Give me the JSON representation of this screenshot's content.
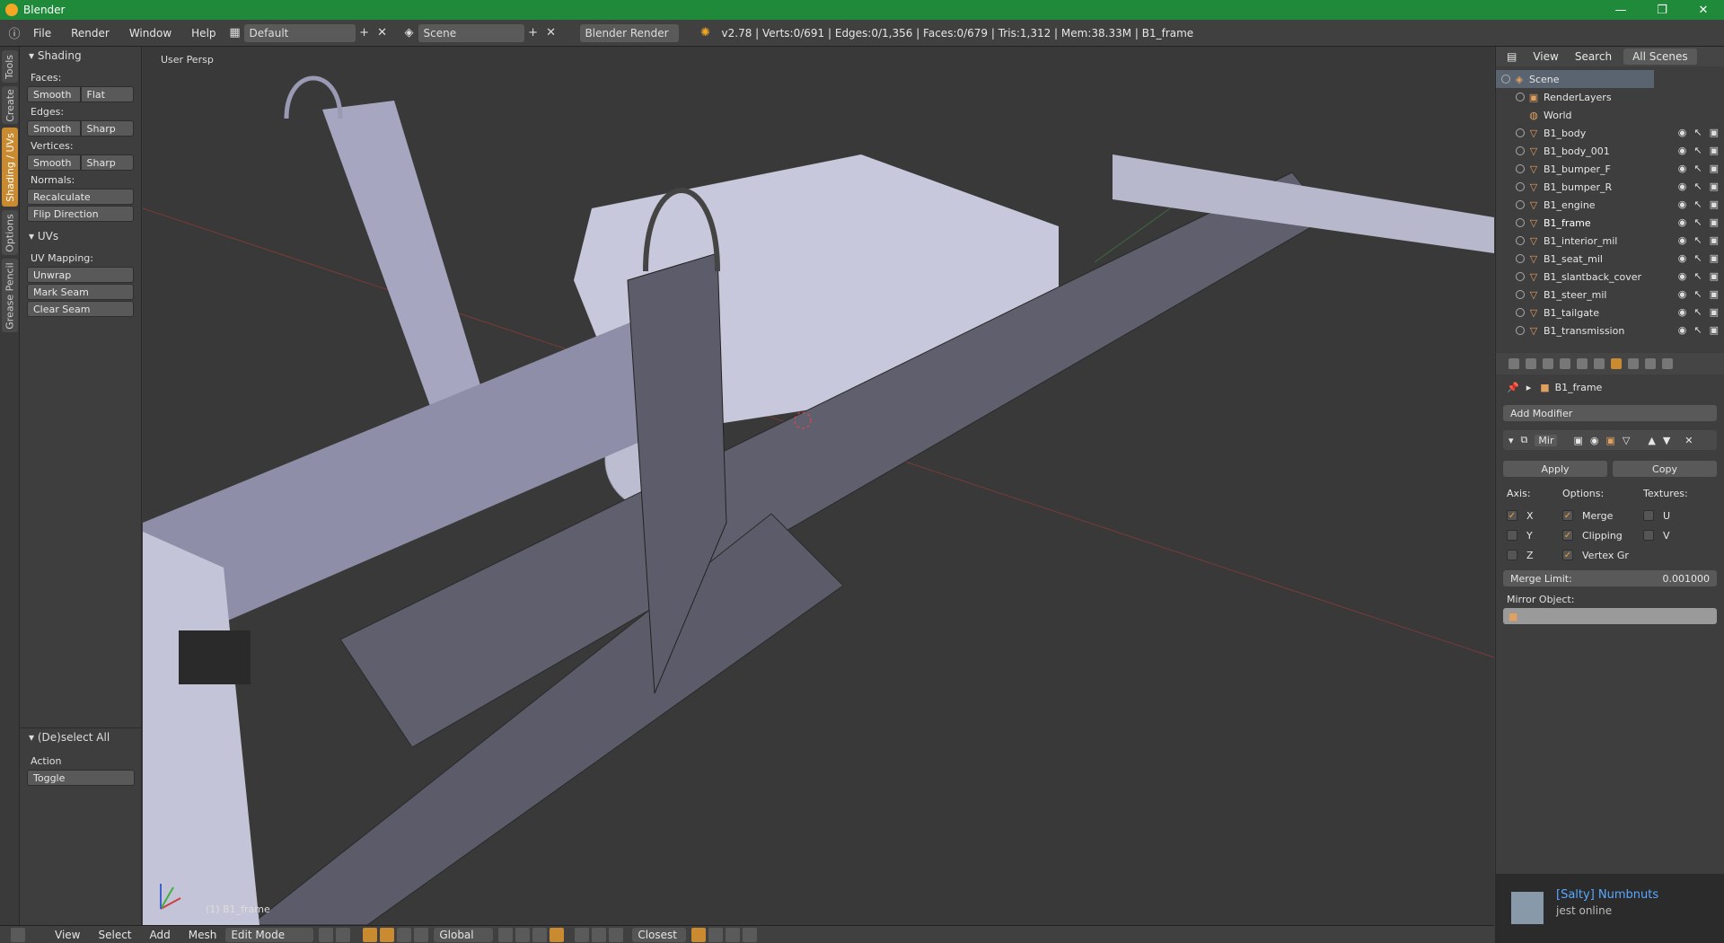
{
  "window": {
    "title": "Blender",
    "minimize": "—",
    "maximize": "❐",
    "close": "✕"
  },
  "topbar": {
    "menus": [
      "File",
      "Render",
      "Window",
      "Help"
    ],
    "layout": "Default",
    "scene": "Scene",
    "engine": "Blender Render",
    "stats": "v2.78 | Verts:0/691 | Edges:0/1,356 | Faces:0/679 | Tris:1,312 | Mem:38.33M | B1_frame"
  },
  "left_tabs": [
    "Tools",
    "Create",
    "Shading / UVs",
    "Options",
    "Grease Pencil"
  ],
  "toolshelf": {
    "shading_header": "Shading",
    "faces_label": "Faces:",
    "faces_smooth": "Smooth",
    "faces_flat": "Flat",
    "edges_label": "Edges:",
    "edges_smooth": "Smooth",
    "edges_sharp": "Sharp",
    "vertices_label": "Vertices:",
    "vertices_smooth": "Smooth",
    "vertices_sharp": "Sharp",
    "normals_label": "Normals:",
    "recalculate": "Recalculate",
    "flip_direction": "Flip Direction",
    "uvs_header": "UVs",
    "uv_mapping_label": "UV Mapping:",
    "unwrap": "Unwrap",
    "mark_seam": "Mark Seam",
    "clear_seam": "Clear Seam",
    "deselect_header": "(De)select All",
    "action_label": "Action",
    "action_value": "Toggle"
  },
  "viewport": {
    "label": "User Persp",
    "object_label": "(1) B1_frame"
  },
  "bottombar": {
    "menus": [
      "View",
      "Select",
      "Add",
      "Mesh"
    ],
    "mode": "Edit Mode",
    "orientation": "Global",
    "snap": "Closest"
  },
  "outliner": {
    "header": {
      "view": "View",
      "search": "Search",
      "filter": "All Scenes"
    },
    "items": [
      {
        "label": "Scene"
      },
      {
        "label": "RenderLayers"
      },
      {
        "label": "World"
      },
      {
        "label": "B1_body"
      },
      {
        "label": "B1_body_001"
      },
      {
        "label": "B1_bumper_F"
      },
      {
        "label": "B1_bumper_R"
      },
      {
        "label": "B1_engine"
      },
      {
        "label": "B1_frame"
      },
      {
        "label": "B1_interior_mil"
      },
      {
        "label": "B1_seat_mil"
      },
      {
        "label": "B1_slantback_cover"
      },
      {
        "label": "B1_steer_mil"
      },
      {
        "label": "B1_tailgate"
      },
      {
        "label": "B1_transmission"
      }
    ]
  },
  "properties": {
    "object_name": "B1_frame",
    "add_modifier": "Add Modifier",
    "modifier_name": "Mir",
    "apply": "Apply",
    "copy": "Copy",
    "axis_label": "Axis:",
    "options_label": "Options:",
    "textures_label": "Textures:",
    "axis_x": "X",
    "axis_y": "Y",
    "axis_z": "Z",
    "merge": "Merge",
    "clipping": "Clipping",
    "vertex_gr": "Vertex Gr",
    "tex_u": "U",
    "tex_v": "V",
    "merge_limit_label": "Merge Limit:",
    "merge_limit_value": "0.001000",
    "mirror_object_label": "Mirror Object:"
  },
  "chat": {
    "name": "[Salty] Numbnuts",
    "status": "jest online"
  }
}
